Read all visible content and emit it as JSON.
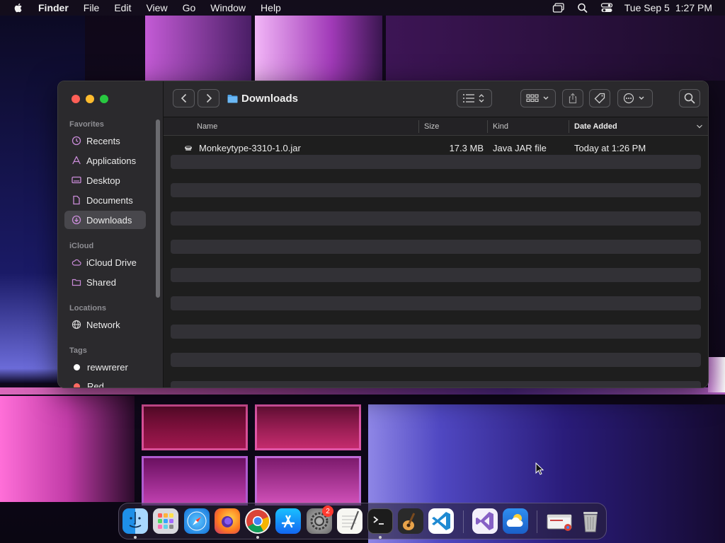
{
  "menubar": {
    "app_name": "Finder",
    "items": [
      "File",
      "Edit",
      "View",
      "Go",
      "Window",
      "Help"
    ],
    "clock_date": "Tue Sep 5",
    "clock_time": "1:27 PM"
  },
  "window": {
    "title": "Downloads",
    "sidebar": {
      "favorites_label": "Favorites",
      "favorites": [
        {
          "label": "Recents",
          "icon": "clock-icon"
        },
        {
          "label": "Applications",
          "icon": "applications-icon"
        },
        {
          "label": "Desktop",
          "icon": "desktop-icon"
        },
        {
          "label": "Documents",
          "icon": "document-icon"
        },
        {
          "label": "Downloads",
          "icon": "download-icon",
          "selected": true
        }
      ],
      "icloud_label": "iCloud",
      "icloud": [
        {
          "label": "iCloud Drive",
          "icon": "cloud-icon"
        },
        {
          "label": "Shared",
          "icon": "shared-folder-icon"
        }
      ],
      "locations_label": "Locations",
      "locations": [
        {
          "label": "Network",
          "icon": "globe-icon"
        }
      ],
      "tags_label": "Tags",
      "tags": [
        {
          "label": "rewwrerer",
          "color": "#ffffff"
        },
        {
          "label": "Red",
          "color": "#ff6961"
        }
      ]
    },
    "columns": {
      "name": "Name",
      "size": "Size",
      "kind": "Kind",
      "date_added": "Date Added"
    },
    "files": [
      {
        "name": "Monkeytype-3310-1.0.jar",
        "size": "17.3 MB",
        "kind": "Java JAR file",
        "date_added": "Today at 1:26 PM"
      }
    ]
  },
  "dock": {
    "apps": [
      "finder-icon",
      "launchpad-icon",
      "safari-icon",
      "firefox-icon",
      "chrome-icon",
      "app-store-icon",
      "system-settings-icon",
      "textedit-icon",
      "terminal-icon",
      "garageband-icon",
      "vscode-icon",
      "visual-studio-icon",
      "weather-icon",
      "chrome-window-icon",
      "trash-icon"
    ],
    "settings_badge": "2"
  },
  "colors": {
    "sidebar_bg": "#2b2a2d",
    "selected_item": "#48474c",
    "window_bg": "#1e1e1e",
    "accent_folder": "#4fa3e8"
  }
}
